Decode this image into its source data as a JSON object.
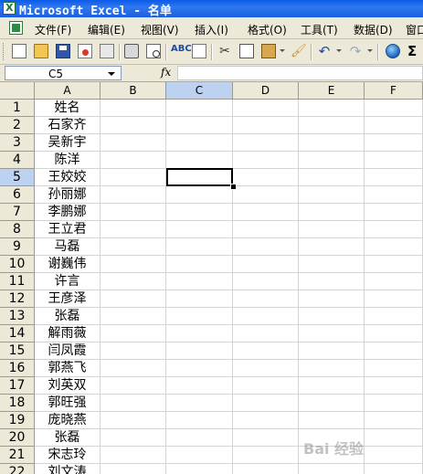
{
  "window": {
    "title": "Microsoft Excel - 名单"
  },
  "menu": {
    "items": [
      "文件(F)",
      "编辑(E)",
      "视图(V)",
      "插入(I)",
      "格式(O)",
      "工具(T)",
      "数据(D)",
      "窗口"
    ]
  },
  "toolbar": {
    "sigma": "Σ"
  },
  "formula_bar": {
    "name_box": "C5",
    "fx_label": "fx",
    "content": ""
  },
  "sheet": {
    "columns": [
      "A",
      "B",
      "C",
      "D",
      "E",
      "F"
    ],
    "active_column": "C",
    "active_row": 5,
    "rows": [
      {
        "num": "1",
        "a": "姓名"
      },
      {
        "num": "2",
        "a": "石家齐"
      },
      {
        "num": "3",
        "a": "吴新宇"
      },
      {
        "num": "4",
        "a": "陈洋"
      },
      {
        "num": "5",
        "a": "王姣姣"
      },
      {
        "num": "6",
        "a": "孙丽娜"
      },
      {
        "num": "7",
        "a": "李鹏娜"
      },
      {
        "num": "8",
        "a": "王立君"
      },
      {
        "num": "9",
        "a": "马磊"
      },
      {
        "num": "10",
        "a": "谢巍伟"
      },
      {
        "num": "11",
        "a": "许言"
      },
      {
        "num": "12",
        "a": "王彦泽"
      },
      {
        "num": "13",
        "a": "张磊"
      },
      {
        "num": "14",
        "a": "解雨薇"
      },
      {
        "num": "15",
        "a": "闫凤霞"
      },
      {
        "num": "16",
        "a": "郭燕飞"
      },
      {
        "num": "17",
        "a": "刘英双"
      },
      {
        "num": "18",
        "a": "郭旺强"
      },
      {
        "num": "19",
        "a": "庞晓燕"
      },
      {
        "num": "20",
        "a": "张磊"
      },
      {
        "num": "21",
        "a": "宋志玲"
      },
      {
        "num": "22",
        "a": "刘文涛"
      }
    ]
  },
  "watermark": "Bai 经验"
}
